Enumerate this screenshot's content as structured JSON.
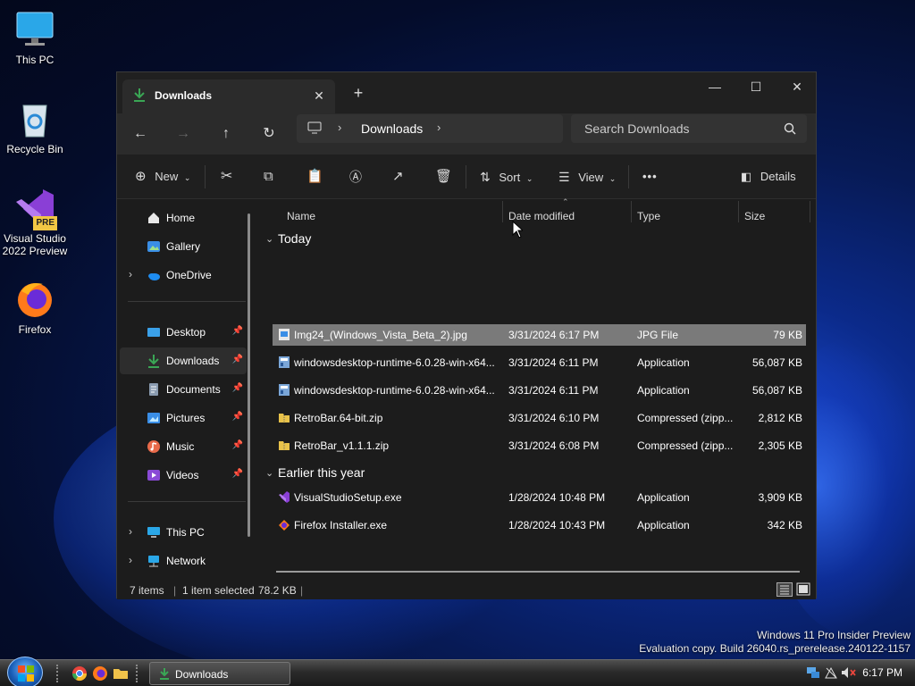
{
  "desktop": {
    "icons": [
      {
        "label": "This PC"
      },
      {
        "label": "Recycle Bin"
      },
      {
        "label": "Visual Studio 2022 Preview",
        "badge": "PRE"
      },
      {
        "label": "Firefox"
      }
    ],
    "watermark": {
      "line1": "Windows 11 Pro Insider Preview",
      "line2": "Evaluation copy. Build 26040.rs_prerelease.240122-1157"
    }
  },
  "window": {
    "tab_title": "Downloads",
    "tab_close": "✕",
    "new_tab": "+",
    "controls": {
      "minimize": "—",
      "maximize": "☐",
      "close": "✕"
    }
  },
  "nav": {
    "back": "←",
    "forward": "→",
    "up": "↑",
    "refresh": "↻",
    "breadcrumb": "Downloads",
    "search_placeholder": "Search Downloads"
  },
  "commandbar": {
    "new_label": "New",
    "sort_label": "Sort",
    "view_label": "View",
    "more_label": "•••",
    "details_label": "Details"
  },
  "sidebar": {
    "items": [
      {
        "label": "Home"
      },
      {
        "label": "Gallery"
      },
      {
        "label": "OneDrive"
      },
      {
        "label": "Desktop"
      },
      {
        "label": "Downloads"
      },
      {
        "label": "Documents"
      },
      {
        "label": "Pictures"
      },
      {
        "label": "Music"
      },
      {
        "label": "Videos"
      },
      {
        "label": "This PC"
      },
      {
        "label": "Network"
      }
    ]
  },
  "files": {
    "columns": {
      "name": "Name",
      "date": "Date modified",
      "type": "Type",
      "size": "Size"
    },
    "groups": [
      {
        "label": "Today"
      },
      {
        "label": "Earlier this year"
      }
    ],
    "rows": [
      {
        "name": "Img24_(Windows_Vista_Beta_2).jpg",
        "date": "3/31/2024 6:17 PM",
        "type": "JPG File",
        "size": "79 KB"
      },
      {
        "name": "windowsdesktop-runtime-6.0.28-win-x64...",
        "date": "3/31/2024 6:11 PM",
        "type": "Application",
        "size": "56,087 KB"
      },
      {
        "name": "windowsdesktop-runtime-6.0.28-win-x64...",
        "date": "3/31/2024 6:11 PM",
        "type": "Application",
        "size": "56,087 KB"
      },
      {
        "name": "RetroBar.64-bit.zip",
        "date": "3/31/2024 6:10 PM",
        "type": "Compressed (zipp...",
        "size": "2,812 KB"
      },
      {
        "name": "RetroBar_v1.1.1.zip",
        "date": "3/31/2024 6:08 PM",
        "type": "Compressed (zipp...",
        "size": "2,305 KB"
      },
      {
        "name": "VisualStudioSetup.exe",
        "date": "1/28/2024 10:48 PM",
        "type": "Application",
        "size": "3,909 KB"
      },
      {
        "name": "Firefox Installer.exe",
        "date": "1/28/2024 10:43 PM",
        "type": "Application",
        "size": "342 KB"
      }
    ]
  },
  "status": {
    "count": "7 items",
    "selected": "1 item selected",
    "size": "78.2 KB",
    "divider": "|"
  },
  "taskbar": {
    "task_label": "Downloads",
    "clock": "6:17 PM"
  },
  "colors": {
    "selection": "#7a7a7a",
    "accent": "#3aa655",
    "window_bg": "#1c1c1c"
  }
}
